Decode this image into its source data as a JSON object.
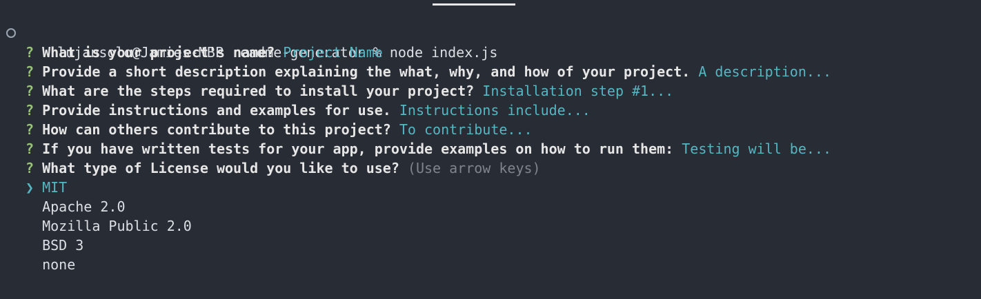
{
  "terminal": {
    "prompt": {
      "user_host": "lujansolo@Jamies-MBP",
      "directory": "readme-generator",
      "symbol": "%",
      "command": "node index.js"
    },
    "qmark": "?",
    "questions": [
      {
        "text": "What is your project's name?",
        "answer": "Project Name"
      },
      {
        "text": "Provide a short description explaining the what, why, and how of your project.",
        "answer": "A description..."
      },
      {
        "text": "What are the steps required to install your project?",
        "answer": "Installation step #1..."
      },
      {
        "text": "Provide instructions and examples for use.",
        "answer": "Instructions include..."
      },
      {
        "text": "How can others contribute to this project?",
        "answer": "To contribute..."
      },
      {
        "text": "If you have written tests for your app, provide examples on how to run them:",
        "answer": "Testing will be..."
      }
    ],
    "license_question": {
      "text": "What type of License would you like to use?",
      "hint": "(Use arrow keys)"
    },
    "pointer": "❯",
    "license_options": [
      "MIT",
      "Apache 2.0",
      "Mozilla Public 2.0",
      "BSD 3",
      "none"
    ],
    "selected_index": 0
  },
  "colors": {
    "background": "#282c34",
    "qmark": "#98c379",
    "answer": "#56b6c2",
    "hint": "#7f848e"
  }
}
